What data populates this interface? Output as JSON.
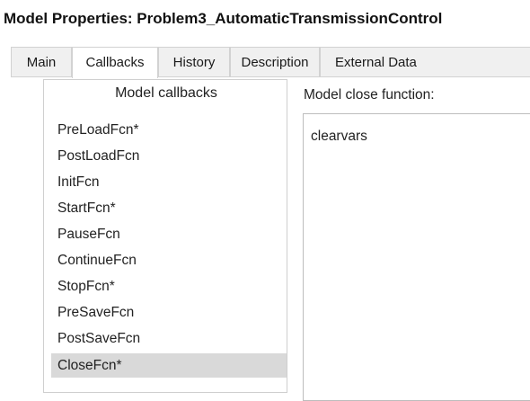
{
  "window": {
    "title": "Model Properties: Problem3_AutomaticTransmissionControl"
  },
  "tabs": [
    {
      "label": "Main",
      "active": false
    },
    {
      "label": "Callbacks",
      "active": true
    },
    {
      "label": "History",
      "active": false
    },
    {
      "label": "Description",
      "active": false
    },
    {
      "label": "External Data",
      "active": false
    }
  ],
  "callbacks": {
    "header": "Model callbacks",
    "items": [
      {
        "label": "PreLoadFcn*",
        "selected": false
      },
      {
        "label": "PostLoadFcn",
        "selected": false
      },
      {
        "label": "InitFcn",
        "selected": false
      },
      {
        "label": "StartFcn*",
        "selected": false
      },
      {
        "label": "PauseFcn",
        "selected": false
      },
      {
        "label": "ContinueFcn",
        "selected": false
      },
      {
        "label": "StopFcn*",
        "selected": false
      },
      {
        "label": "PreSaveFcn",
        "selected": false
      },
      {
        "label": "PostSaveFcn",
        "selected": false
      },
      {
        "label": "CloseFcn*",
        "selected": true
      }
    ]
  },
  "editor": {
    "label": "Model close function:",
    "content": "clearvars"
  },
  "colors": {
    "selected_row": "#d9d9d9",
    "tab_inactive": "#f0f0f0",
    "border": "#cfcfcf"
  }
}
